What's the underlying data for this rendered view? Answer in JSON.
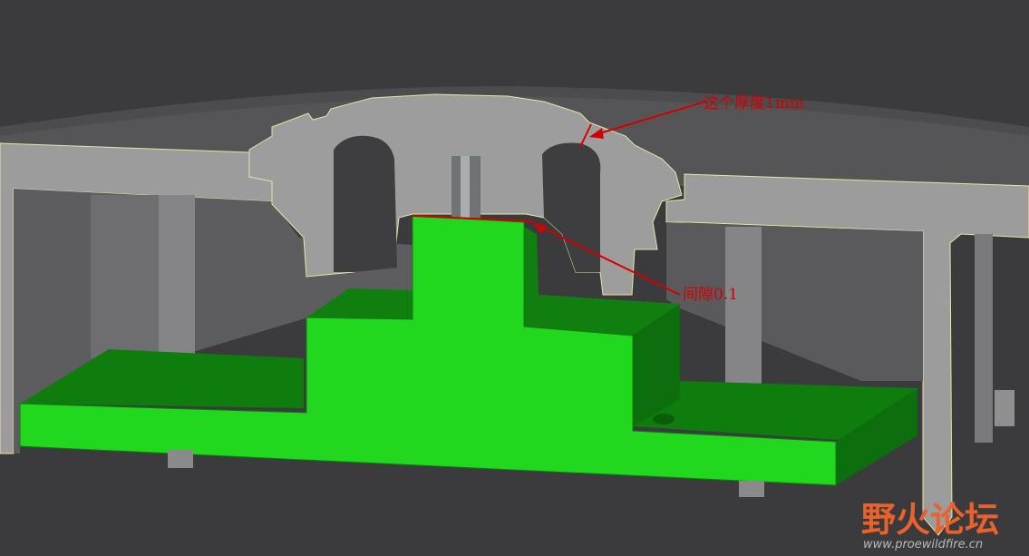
{
  "annotations": [
    {
      "id": "thickness",
      "text": "这个厚度1mm"
    },
    {
      "id": "gap",
      "text": "间隙0.1"
    }
  ],
  "watermark": {
    "brand": "野火论坛",
    "url": "www.proewildfire.cn"
  },
  "colors": {
    "background": "#3a3a3d",
    "housing_section": "#9d9d9d",
    "housing_dark": "#565656",
    "part_green": "#22d81f",
    "part_green_dark": "#0f7a0e",
    "annotation_red": "#d40000",
    "watermark_orange": "#e9622b",
    "watermark_gray": "#bdbdbd"
  }
}
